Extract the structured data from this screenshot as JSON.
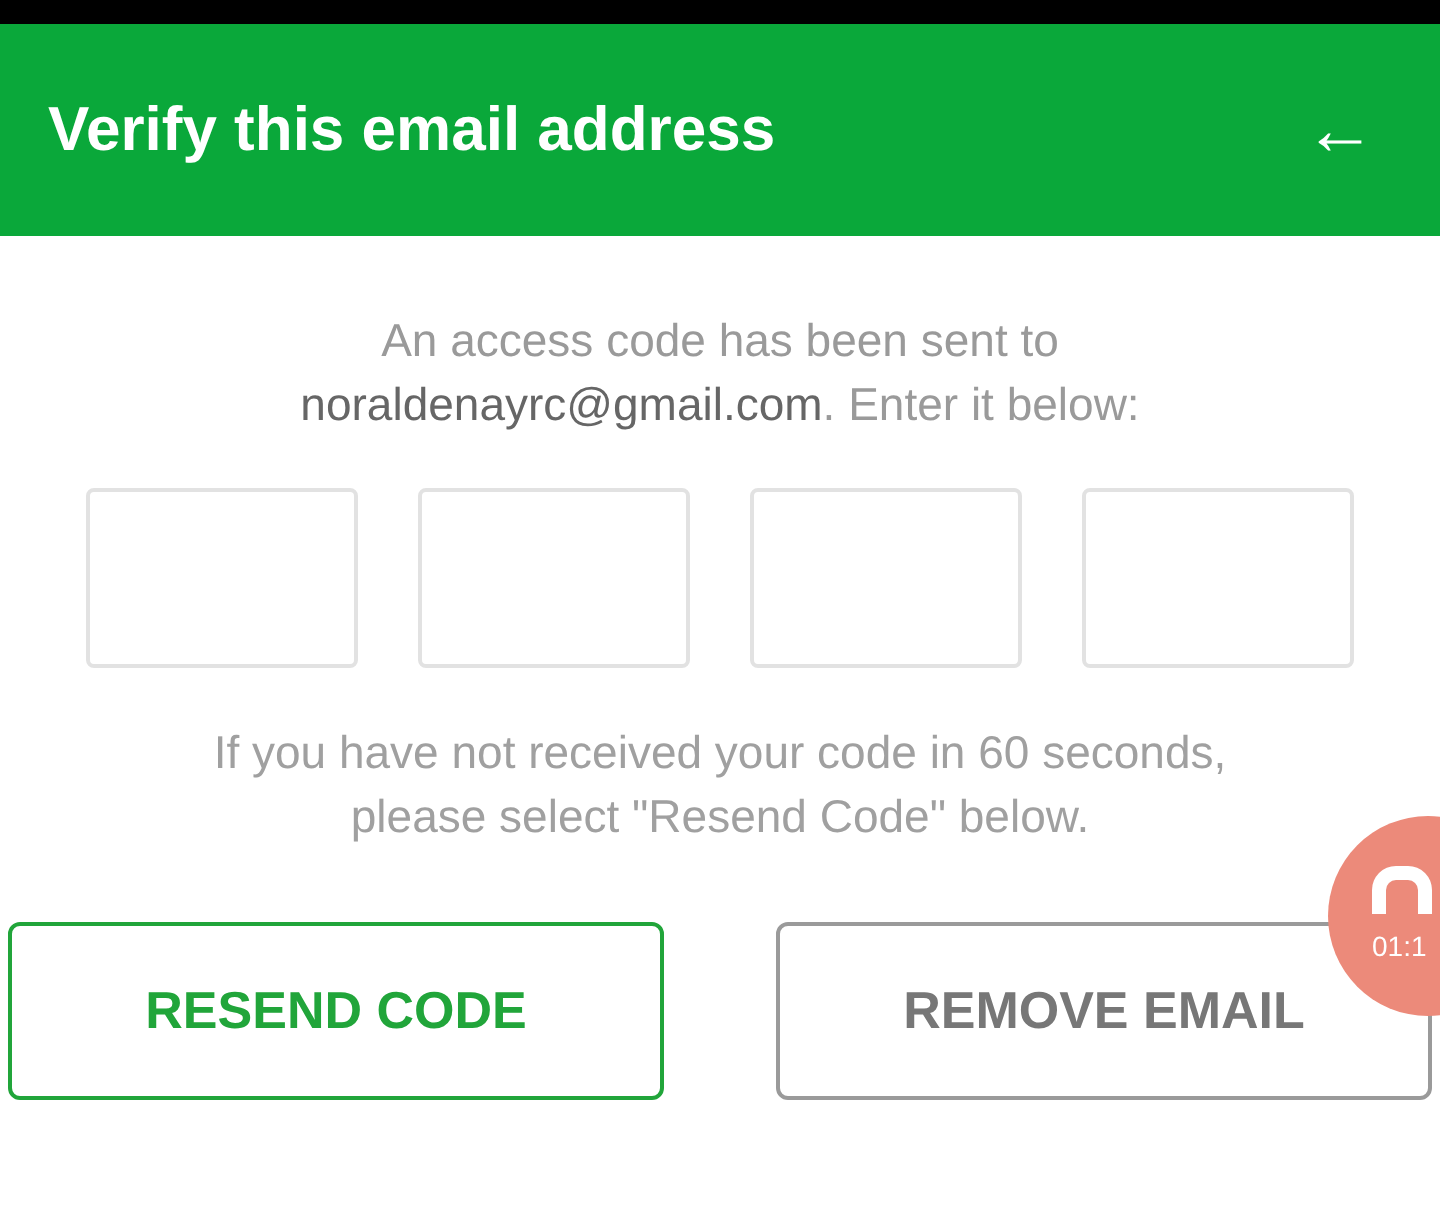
{
  "header": {
    "title": "Verify this email address",
    "back_icon": "←"
  },
  "message": {
    "intro": "An access code has been sent to",
    "email": "noraldenayrc@gmail.com",
    "outro": ". Enter it below:"
  },
  "code_fields": [
    {
      "kind": "digit"
    },
    {
      "kind": "digit"
    },
    {
      "kind": "digit"
    },
    {
      "kind": "digit"
    }
  ],
  "hint": "If you have not received your code in 60 seconds, please select \"Resend Code\" below.",
  "buttons": [
    {
      "label": "RESEND CODE",
      "kind": "primary"
    },
    {
      "label": "REMOVE EMAIL",
      "kind": "secondary"
    }
  ],
  "recorder_bubble": {
    "time": "01:1"
  }
}
